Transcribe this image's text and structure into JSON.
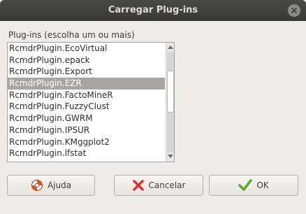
{
  "window": {
    "title": "Carregar Plug-ins"
  },
  "dialog": {
    "list_label": "Plug-ins (escolha um ou mais)",
    "plugins": [
      "RcmdrPlugin.EcoVirtual",
      "RcmdrPlugin.epack",
      "RcmdrPlugin.Export",
      "RcmdrPlugin.EZR",
      "RcmdrPlugin.FactoMineR",
      "RcmdrPlugin.FuzzyClust",
      "RcmdrPlugin.GWRM",
      "RcmdrPlugin.IPSUR",
      "RcmdrPlugin.KMggplot2",
      "RcmdrPlugin.lfstat"
    ],
    "selected_plugin": "RcmdrPlugin.EZR"
  },
  "buttons": {
    "help_label": "Ajuda",
    "cancel_label": "Cancelar",
    "ok_label": "OK"
  },
  "icons": {
    "close": "close-icon",
    "help": "lifebuoy-icon",
    "cancel": "red-x-icon",
    "ok": "green-check-icon",
    "scroll_up": "arrow-up-icon",
    "scroll_down": "arrow-down-icon"
  },
  "colors": {
    "titlebar": "#3c3b37",
    "selection": "#a9a6a1",
    "cancel_icon": "#d9352b",
    "ok_icon": "#5ea72a"
  }
}
